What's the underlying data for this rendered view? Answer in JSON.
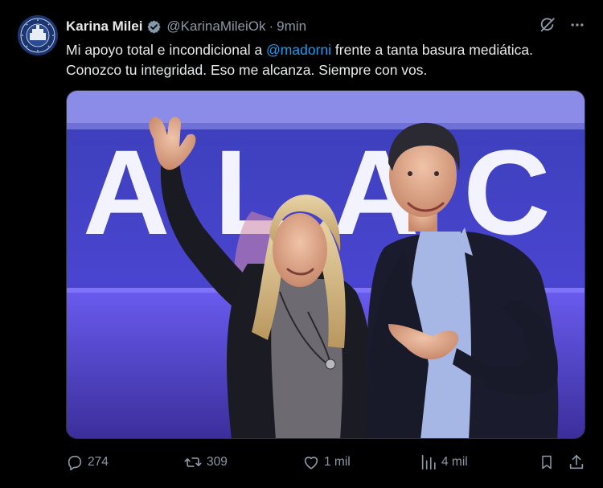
{
  "tweet": {
    "author_name": "Karina Milei",
    "handle": "@KarinaMileiOk",
    "separator": "·",
    "time": "9min",
    "text_before": "Mi apoyo total e incondicional a ",
    "mention": "@madorni",
    "text_after": " frente a tanta basura mediática. Conozco tu integridad. Eso me alcanza. Siempre con vos.",
    "media_backdrop_text": "ALAC"
  },
  "actions": {
    "replies": "274",
    "reposts": "309",
    "likes": "1 mil",
    "views": "4 mil"
  },
  "colors": {
    "background": "#000000",
    "text": "#e7e9ea",
    "muted": "#8b98a5",
    "link": "#1d9bf0",
    "verified_badge": "#829aab"
  },
  "icons": {
    "verified": "verified-badge-icon",
    "grok": "grok-icon",
    "more": "more-icon",
    "reply": "reply-icon",
    "repost": "repost-icon",
    "like": "like-icon",
    "views": "views-icon",
    "bookmark": "bookmark-icon",
    "share": "share-icon"
  }
}
